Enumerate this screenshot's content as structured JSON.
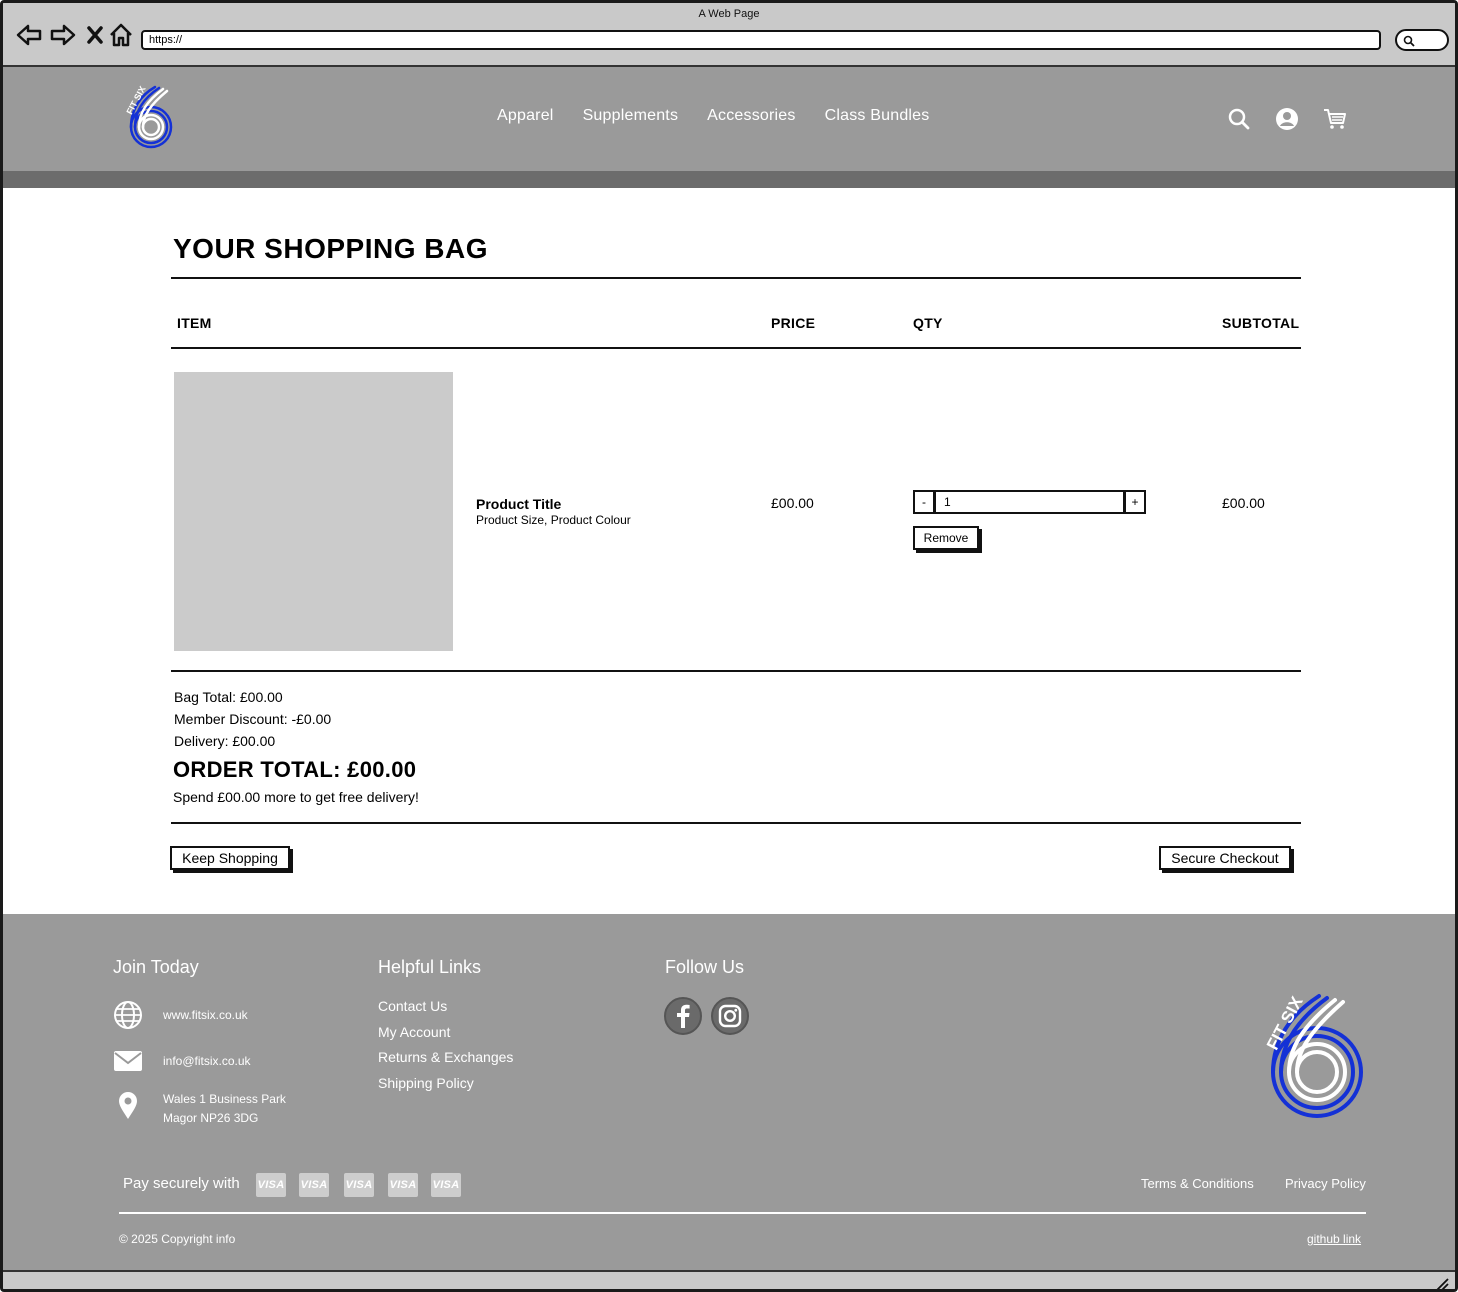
{
  "browser": {
    "window_title": "A Web Page",
    "url": "https://"
  },
  "header": {
    "logo_text": "FIT SIX",
    "nav": [
      {
        "label": "Apparel"
      },
      {
        "label": "Supplements"
      },
      {
        "label": "Accessories"
      },
      {
        "label": "Class Bundles"
      }
    ],
    "icons": [
      "search-icon",
      "account-icon",
      "cart-icon"
    ]
  },
  "bag": {
    "title": "YOUR SHOPPING BAG",
    "columns": {
      "item": "ITEM",
      "price": "PRICE",
      "qty": "QTY",
      "subtotal": "SUBTOTAL"
    },
    "items": [
      {
        "title": "Product Title",
        "meta": "Product Size, Product Colour",
        "price": "£00.00",
        "qty": "1",
        "subtotal": "£00.00",
        "decrement_label": "-",
        "increment_label": "+",
        "remove_label": "Remove"
      }
    ],
    "summary": {
      "bag_total": "Bag Total: £00.00",
      "member_discount": "Member Discount: -£0.00",
      "delivery": "Delivery: £00.00",
      "order_total": "ORDER TOTAL: £00.00",
      "free_delivery_note": "Spend £00.00 more to get free delivery!"
    },
    "actions": {
      "keep_shopping": "Keep Shopping",
      "secure_checkout": "Secure Checkout"
    }
  },
  "footer": {
    "join": {
      "heading": "Join Today",
      "website": "www.fitsix.co.uk",
      "email": "info@fitsix.co.uk",
      "address_line1": "Wales 1 Business Park",
      "address_line2": "Magor NP26 3DG"
    },
    "helpful_links": {
      "heading": "Helpful Links",
      "links": [
        {
          "label": "Contact Us"
        },
        {
          "label": "My Account"
        },
        {
          "label": "Returns & Exchanges"
        },
        {
          "label": "Shipping Policy"
        }
      ]
    },
    "follow": {
      "heading": "Follow Us",
      "icons": [
        "facebook-icon",
        "instagram-icon"
      ]
    },
    "logo_text": "FIT SIX",
    "pay_label": "Pay securely with",
    "cards": [
      "VISA",
      "VISA",
      "VISA",
      "VISA",
      "VISA"
    ],
    "terms": "Terms & Conditions",
    "privacy": "Privacy Policy",
    "copyright": "© 2025 Copyright info",
    "github": "github link"
  },
  "colors": {
    "header_bg": "#9a9a9a",
    "header_strip": "#6c6c6c",
    "footer_bg": "#9a9a9a",
    "logo_blue": "#1431d6",
    "placeholder_image": "#cbcbcb"
  }
}
